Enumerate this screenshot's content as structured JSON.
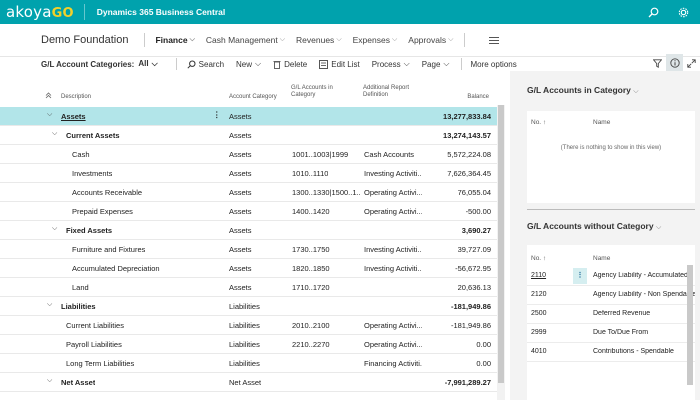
{
  "topbar": {
    "logo_main": "akoya",
    "logo_go": "GO",
    "app_title": "Dynamics 365 Business Central",
    "icons": [
      "search-icon",
      "settings-gear-icon"
    ]
  },
  "nav": {
    "company": "Demo Foundation",
    "items": [
      {
        "label": "Finance",
        "chev": "⌵",
        "active": true
      },
      {
        "label": "Cash Management",
        "chev": "⌵"
      },
      {
        "label": "Revenues",
        "chev": "⌵"
      },
      {
        "label": "Expenses",
        "chev": "⌵"
      },
      {
        "label": "Approvals",
        "chev": "⌵"
      }
    ]
  },
  "actions": {
    "filter_label": "G/L Account Categories:",
    "filter_value": "All",
    "filter_chev": "⌵",
    "search": "Search",
    "new": "New",
    "new_chev": "⌵",
    "delete": "Delete",
    "edit_list": "Edit List",
    "process": "Process",
    "process_chev": "⌵",
    "page": "Page",
    "page_chev": "⌵",
    "more_options": "More options"
  },
  "table": {
    "columns": {
      "description": "Description",
      "account_category": "Account Category",
      "gl_accounts_line1": "G/L Accounts in",
      "gl_accounts_line2": "Category",
      "add_report_line1": "Additional Report",
      "add_report_line2": "Definition",
      "balance": "Balance"
    },
    "rows": [
      {
        "indent": 0,
        "expander": "⌵",
        "desc": "Assets",
        "bold": true,
        "underline": true,
        "cat": "Assets",
        "gl": "",
        "rep": "",
        "bal": "13,277,833.84",
        "selected": true
      },
      {
        "indent": 1,
        "expander": "⌵",
        "desc": "Current Assets",
        "bold": true,
        "cat": "Assets",
        "gl": "",
        "rep": "",
        "bal": "13,274,143.57"
      },
      {
        "indent": 2,
        "expander": "",
        "desc": "Cash",
        "cat": "Assets",
        "gl": "1001..1003|1999",
        "rep": "Cash Accounts",
        "bal": "5,572,224.08"
      },
      {
        "indent": 2,
        "expander": "",
        "desc": "Investments",
        "cat": "Assets",
        "gl": "1010..1110",
        "rep": "Investing Activiti...",
        "bal": "7,626,364.45"
      },
      {
        "indent": 2,
        "expander": "",
        "desc": "Accounts Receivable",
        "cat": "Assets",
        "gl": "1300..1330|1500..1...",
        "rep": "Operating Activi...",
        "bal": "76,055.04"
      },
      {
        "indent": 2,
        "expander": "",
        "desc": "Prepaid Expenses",
        "cat": "Assets",
        "gl": "1400..1420",
        "rep": "Operating Activi...",
        "bal": "-500.00"
      },
      {
        "indent": 1,
        "expander": "⌵",
        "desc": "Fixed Assets",
        "bold": true,
        "cat": "Assets",
        "gl": "",
        "rep": "",
        "bal": "3,690.27"
      },
      {
        "indent": 2,
        "expander": "",
        "desc": "Furniture and Fixtures",
        "cat": "Assets",
        "gl": "1730..1750",
        "rep": "Investing Activiti...",
        "bal": "39,727.09"
      },
      {
        "indent": 2,
        "expander": "",
        "desc": "Accumulated Depreciation",
        "cat": "Assets",
        "gl": "1820..1850",
        "rep": "Investing Activiti...",
        "bal": "-56,672.95"
      },
      {
        "indent": 2,
        "expander": "",
        "desc": "Land",
        "cat": "Assets",
        "gl": "1710..1720",
        "rep": "",
        "bal": "20,636.13"
      },
      {
        "indent": 0,
        "expander": "⌵",
        "desc": "Liabilities",
        "bold": true,
        "cat": "Liabilities",
        "gl": "",
        "rep": "",
        "bal": "-181,949.86"
      },
      {
        "indent": 1,
        "expander": "",
        "desc": "Current Liabilities",
        "cat": "Liabilities",
        "gl": "2010..2100",
        "rep": "Operating Activi...",
        "bal": "-181,949.86"
      },
      {
        "indent": 1,
        "expander": "",
        "desc": "Payroll Liabilities",
        "cat": "Liabilities",
        "gl": "2210..2270",
        "rep": "Operating Activi...",
        "bal": "0.00"
      },
      {
        "indent": 1,
        "expander": "",
        "desc": "Long Term Liabilities",
        "cat": "Liabilities",
        "gl": "",
        "rep": "Financing Activiti...",
        "bal": "0.00"
      },
      {
        "indent": 0,
        "expander": "⌵",
        "desc": "Net Asset",
        "bold": true,
        "cat": "Net Asset",
        "gl": "",
        "rep": "",
        "bal": "-7,991,289.27"
      }
    ]
  },
  "panel1": {
    "title": "G/L Accounts in Category",
    "title_chev": "⌵",
    "col_no": "No. ↑",
    "col_name": "Name",
    "empty": "(There is nothing to show in this view)"
  },
  "panel2": {
    "title": "G/L Accounts without Category",
    "title_chev": "⌵",
    "col_no": "No. ↑",
    "col_name": "Name",
    "rows": [
      {
        "no": "2110",
        "name": "Agency Liability - Accumulated"
      },
      {
        "no": "2120",
        "name": "Agency Liability - Non Spendable"
      },
      {
        "no": "2500",
        "name": "Deferred Revenue"
      },
      {
        "no": "2999",
        "name": "Due To/Due From"
      },
      {
        "no": "4010",
        "name": "Contributions - Spendable"
      }
    ]
  }
}
